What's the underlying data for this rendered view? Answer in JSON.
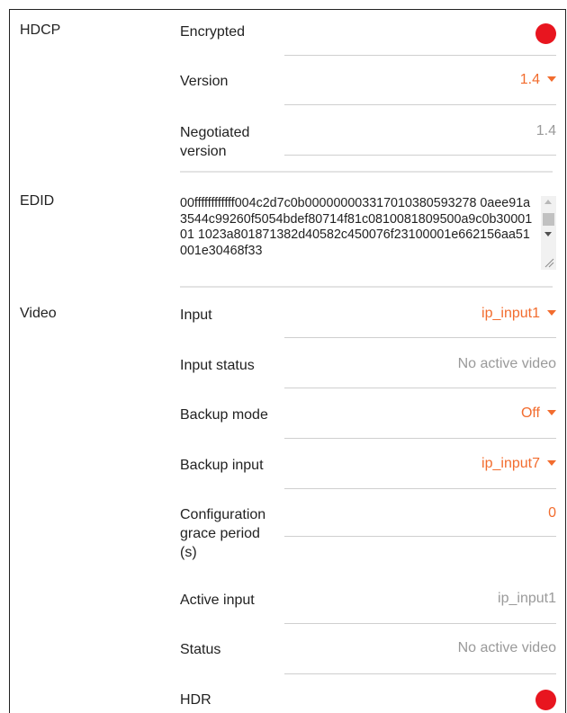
{
  "hdcp": {
    "section_label": "HDCP",
    "encrypted_label": "Encrypted",
    "encrypted_state": "on",
    "version_label": "Version",
    "version_value": "1.4",
    "negotiated_label_line1": "Negotiated",
    "negotiated_label_line2": "version",
    "negotiated_value": "1.4"
  },
  "edid": {
    "section_label": "EDID",
    "value": "00ffffffffffff004c2d7c0b000000003317010380593278 0aee91a3544c99260f5054bdef80714f81c0810081809500a9c0b3000101 1023a801871382d40582c450076f23100001e662156aa51001e30468f33"
  },
  "video": {
    "section_label": "Video",
    "input_label": "Input",
    "input_value": "ip_input1",
    "input_status_label": "Input status",
    "input_status_value": "No active video",
    "backup_mode_label": "Backup mode",
    "backup_mode_value": "Off",
    "backup_input_label": "Backup input",
    "backup_input_value": "ip_input7",
    "grace_label_line1": "Configuration",
    "grace_label_line2": "grace period",
    "grace_label_line3": "(s)",
    "grace_value": "0",
    "active_input_label": "Active input",
    "active_input_value": "ip_input1",
    "status_label": "Status",
    "status_value": "No active video",
    "hdr_label": "HDR",
    "hdr_state": "on"
  },
  "colors": {
    "accent": "#f26c2e",
    "indicator_red": "#e8151f",
    "muted_text": "#9a9a9a"
  },
  "icons": {
    "dropdown": "caret-down-icon",
    "indicator": "status-dot-icon"
  }
}
